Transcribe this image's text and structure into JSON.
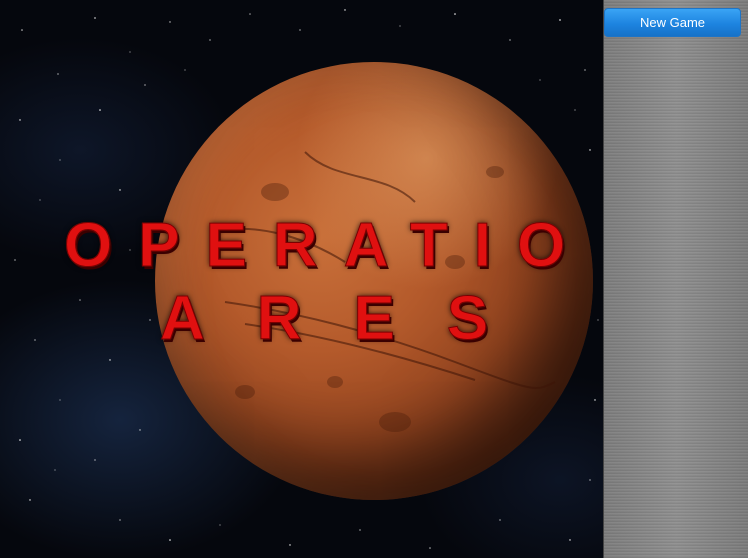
{
  "game": {
    "title_line_1": "OPERATIO",
    "title_line_2": "ARES",
    "title_color": "#e01010",
    "background_color": "#05070d",
    "planet_color": "#b45a2b"
  },
  "side_panel": {
    "new_game_label": "New Game",
    "button_color": "#1d84e0",
    "panel_color": "#868686"
  }
}
